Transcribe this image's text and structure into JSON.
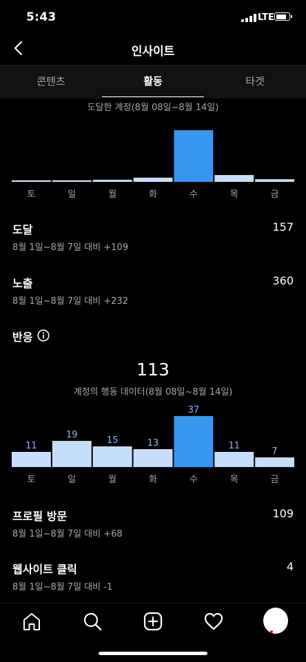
{
  "status_bar": {
    "time": "5:43",
    "network": "LTE",
    "battery_level": 0.85
  },
  "header": {
    "title": "인사이트",
    "back_icon": "chevron-left-icon"
  },
  "tabs": [
    {
      "label": "콘텐츠",
      "active": false
    },
    {
      "label": "활동",
      "active": true
    },
    {
      "label": "타겟",
      "active": false
    }
  ],
  "reach_chart": {
    "caption": "도달한 계정(8월 08일~8월 14일)"
  },
  "stats": {
    "reach": {
      "label": "도달",
      "value": "157",
      "comparison": "8월 1일~8월 7일 대비 +109"
    },
    "impressions": {
      "label": "노출",
      "value": "360",
      "comparison": "8월 1일~8월 7일 대비 +232"
    }
  },
  "interactions": {
    "title": "반응",
    "total": "113",
    "caption": "계정의 행동 데이터(8월 08일~8월 14일)"
  },
  "actions": {
    "profile_visits": {
      "label": "프로필 방문",
      "value": "109",
      "comparison": "8월 1일~8월 7일 대비 +68"
    },
    "website_clicks": {
      "label": "웹사이트 클릭",
      "value": "4",
      "comparison": "8월 1일~8월 7일 대비 -1"
    }
  },
  "chart_data": [
    {
      "type": "bar",
      "categories": [
        "토",
        "일",
        "월",
        "화",
        "수",
        "목",
        "금"
      ],
      "values": [
        3,
        3,
        4,
        8,
        98,
        13,
        5
      ],
      "highlight_index": 4,
      "colors": {
        "highlight": "#3897f0",
        "normal": "#c7defa"
      }
    },
    {
      "type": "bar",
      "categories": [
        "토",
        "일",
        "월",
        "화",
        "수",
        "목",
        "금"
      ],
      "values": [
        11,
        19,
        15,
        13,
        37,
        11,
        7
      ],
      "data_labels": [
        "11",
        "19",
        "15",
        "13",
        "37",
        "11",
        "7"
      ],
      "highlight_index": 4,
      "colors": {
        "highlight": "#3897f0",
        "normal": "#c7defa",
        "label": "#8ab8f5"
      }
    }
  ],
  "bottom_nav": {
    "icons": [
      "home-icon",
      "search-icon",
      "add-post-icon",
      "heart-icon",
      "profile-avatar"
    ]
  }
}
